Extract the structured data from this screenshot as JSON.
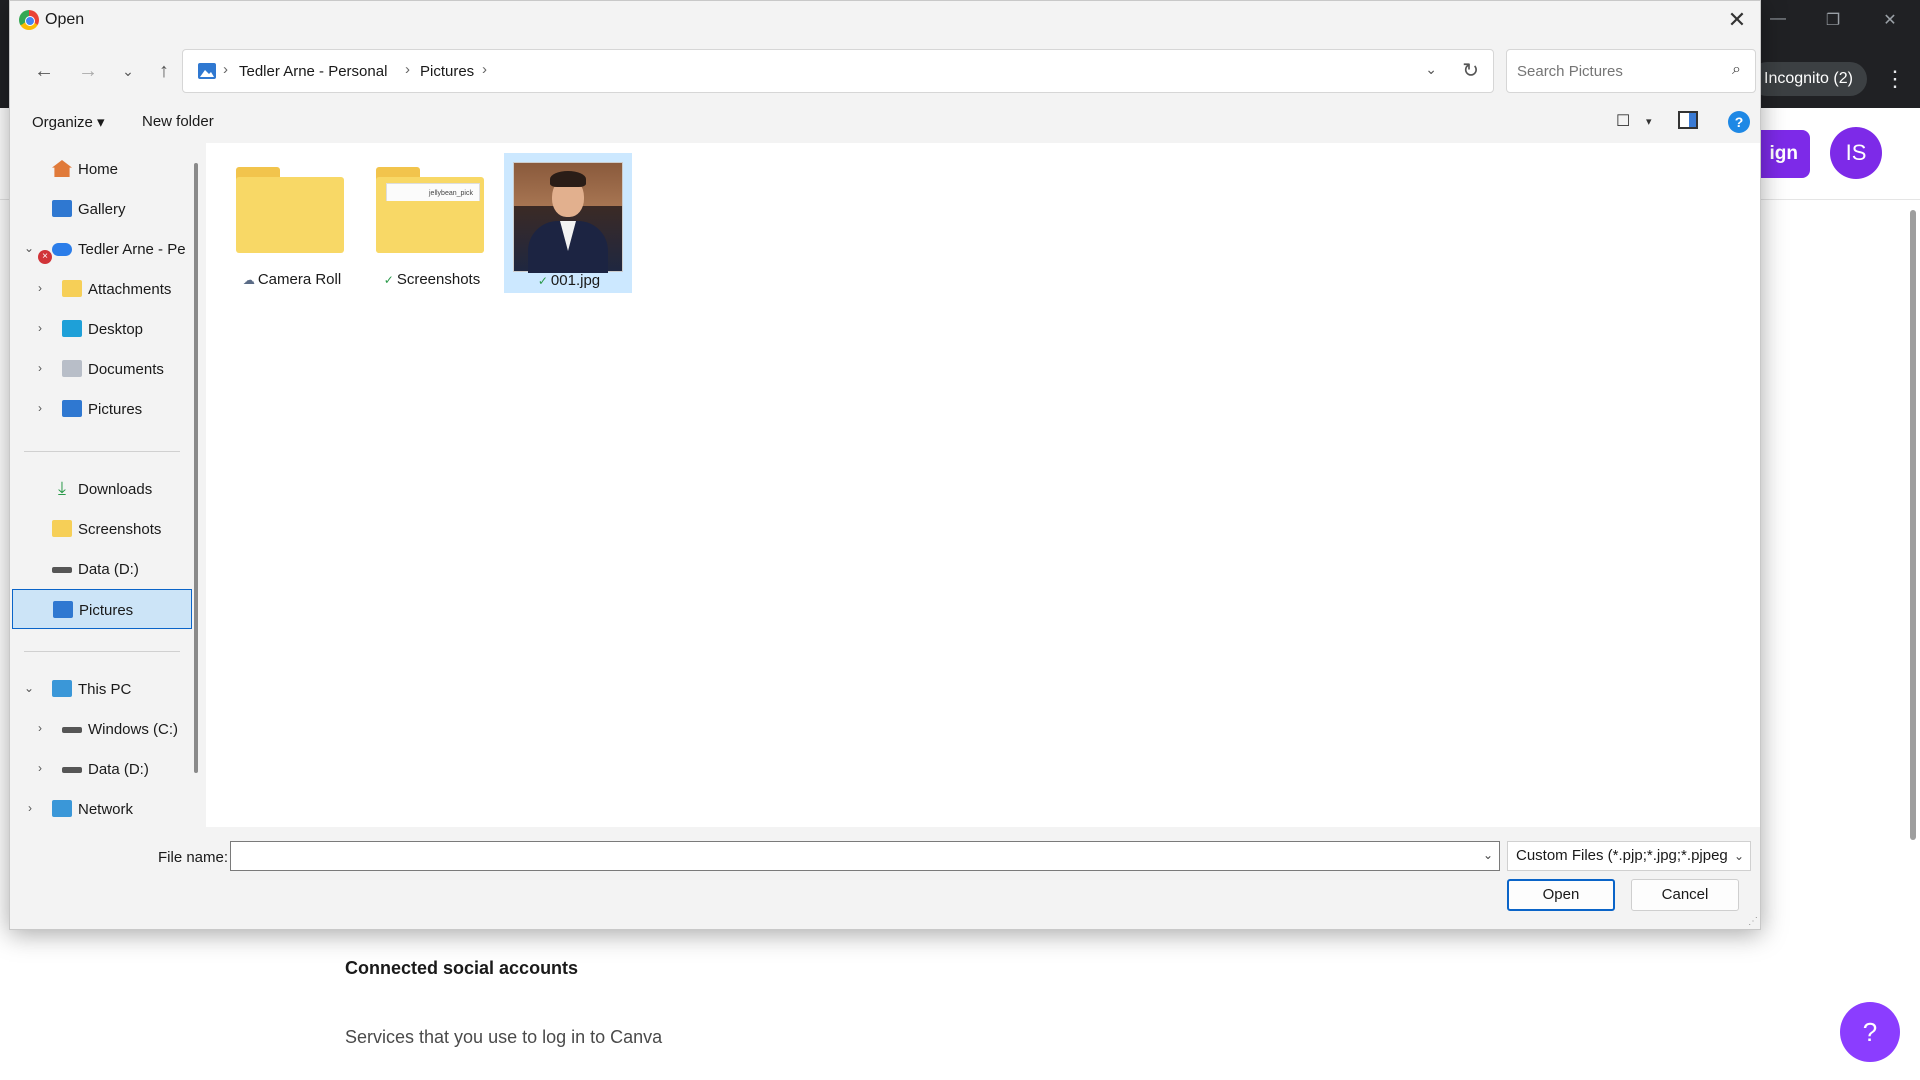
{
  "background": {
    "incognito_label": "Incognito (2)",
    "menu_icon": "⋮",
    "sign_button_label": "ign",
    "avatar_initials": "IS",
    "section_title": "Connected social accounts",
    "section_description": "Services that you use to log in to Canva",
    "help_button": "?",
    "accent_color": "#7d2ae8"
  },
  "dialog": {
    "title": "Open",
    "close_icon": "✕",
    "nav": {
      "back": "←",
      "forward": "→",
      "recent": "⌄",
      "up": "↑",
      "refresh": "↻",
      "dropdown": "⌄"
    },
    "breadcrumbs": [
      {
        "label": "Tedler Arne - Personal"
      },
      {
        "label": "Pictures"
      }
    ],
    "crumb_separator": "›",
    "search": {
      "placeholder": "Search Pictures",
      "icon": "⌕"
    },
    "toolbar": {
      "organize_label": "Organize ▾",
      "new_folder_label": "New folder",
      "view_icon": "☐",
      "view_dropdown": "▾",
      "help_icon": "?"
    },
    "sidebar": {
      "items": [
        {
          "label": "Home",
          "icon": "home-icon"
        },
        {
          "label": "Gallery",
          "icon": "gallery-icon"
        },
        {
          "label": "Tedler Arne - Pe",
          "icon": "onedrive-cloud-icon",
          "expanded": true,
          "error": "×"
        },
        {
          "label": "Attachments",
          "icon": "folder-icon"
        },
        {
          "label": "Desktop",
          "icon": "desktop-icon"
        },
        {
          "label": "Documents",
          "icon": "documents-icon"
        },
        {
          "label": "Pictures",
          "icon": "pictures-icon"
        },
        {
          "label": "Downloads",
          "icon": "download-icon"
        },
        {
          "label": "Screenshots",
          "icon": "folder-icon"
        },
        {
          "label": "Data (D:)",
          "icon": "drive-icon"
        },
        {
          "label": "Pictures",
          "icon": "pictures-icon",
          "selected": true
        },
        {
          "label": "This PC",
          "icon": "pc-icon",
          "expanded": true
        },
        {
          "label": "Windows (C:)",
          "icon": "drive-icon"
        },
        {
          "label": "Data (D:)",
          "icon": "drive-icon"
        },
        {
          "label": "Network",
          "icon": "network-icon"
        }
      ],
      "chevron_expanded": "⌄",
      "chevron_collapsed": "›",
      "download_glyph": "⤓"
    },
    "files": [
      {
        "name": "Camera Roll",
        "type": "folder",
        "status": "☁",
        "status_kind": "cloud"
      },
      {
        "name": "Screenshots",
        "type": "folder",
        "status": "✓",
        "status_kind": "synced",
        "preview_text": "jellybean_pick"
      },
      {
        "name": "001.jpg",
        "type": "image",
        "status": "✓",
        "status_kind": "synced",
        "selected": true
      }
    ],
    "footer": {
      "file_name_label": "File name:",
      "file_name_value": "",
      "file_type_selected": "Custom Files (*.pjp;*.jpg;*.pjpeg",
      "dropdown_icon": "⌄",
      "open_label": "Open",
      "cancel_label": "Cancel",
      "resize_grip": "⋰"
    }
  }
}
